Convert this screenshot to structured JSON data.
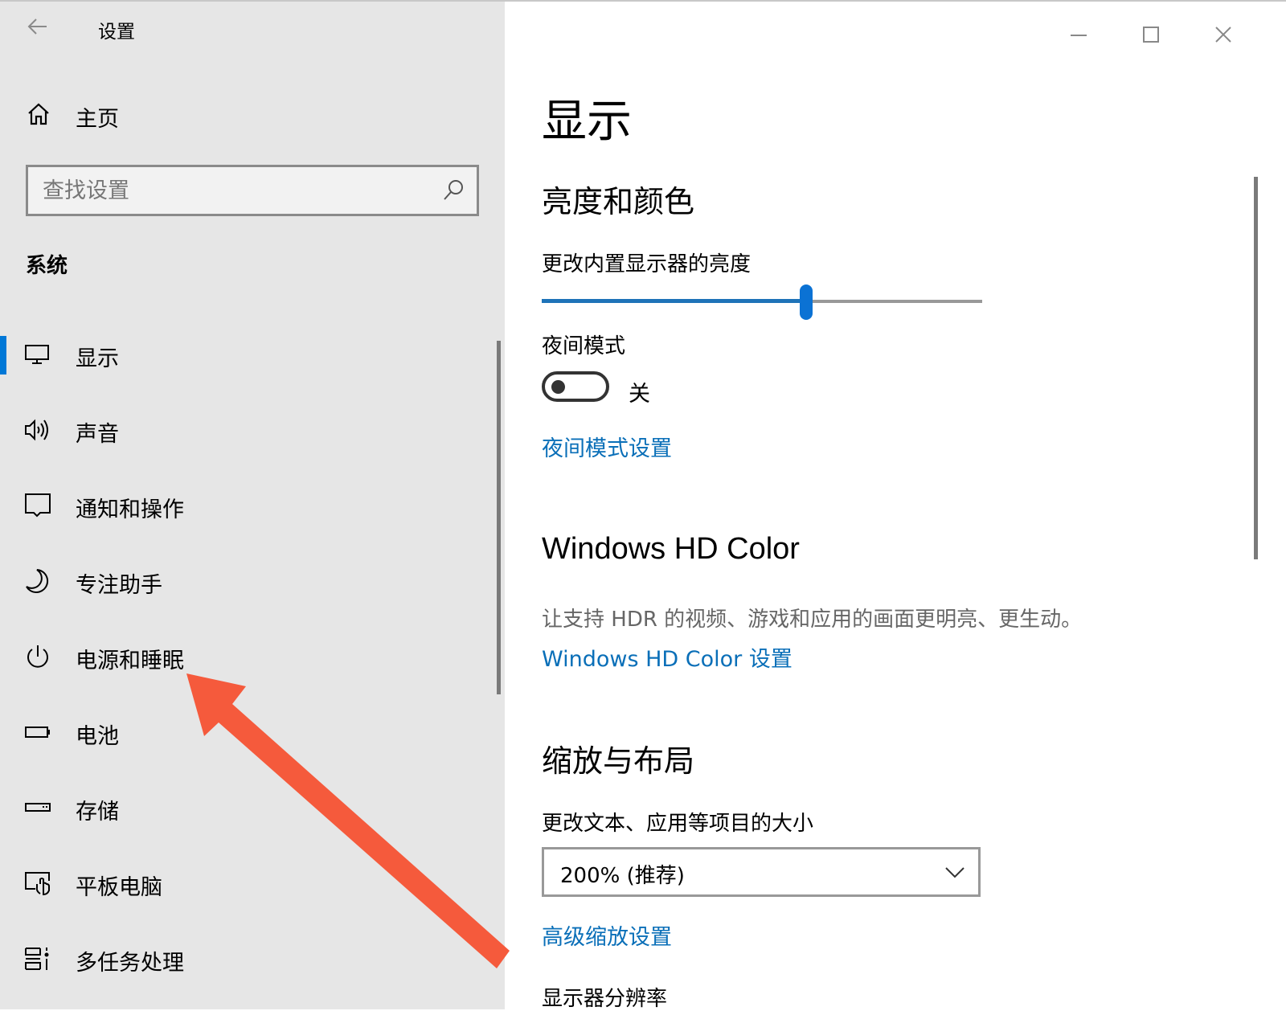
{
  "window": {
    "app_title": "设置",
    "controls": {
      "minimize": "minimize-icon",
      "maximize": "maximize-icon",
      "close": "close-icon"
    }
  },
  "sidebar": {
    "back_icon": "arrow-left-icon",
    "home": {
      "label": "主页",
      "icon": "home-icon"
    },
    "search": {
      "placeholder": "查找设置",
      "value": "",
      "icon": "search-icon"
    },
    "group_title": "系统",
    "items": [
      {
        "label": "显示",
        "icon": "monitor-icon",
        "selected": true
      },
      {
        "label": "声音",
        "icon": "speaker-icon",
        "selected": false
      },
      {
        "label": "通知和操作",
        "icon": "notification-icon",
        "selected": false
      },
      {
        "label": "专注助手",
        "icon": "moon-icon",
        "selected": false
      },
      {
        "label": "电源和睡眠",
        "icon": "power-icon",
        "selected": false
      },
      {
        "label": "电池",
        "icon": "battery-icon",
        "selected": false
      },
      {
        "label": "存储",
        "icon": "storage-icon",
        "selected": false
      },
      {
        "label": "平板电脑",
        "icon": "tablet-icon",
        "selected": false
      },
      {
        "label": "多任务处理",
        "icon": "multitask-icon",
        "selected": false
      }
    ],
    "accent_color": "#0078d7"
  },
  "main": {
    "page_title": "显示",
    "brightness_section": {
      "heading": "亮度和颜色",
      "slider_label": "更改内置显示器的亮度",
      "brightness_percent": 60,
      "night_light_label": "夜间模式",
      "night_light_state": "关",
      "night_light_on": false,
      "night_light_link": "夜间模式设置"
    },
    "hd_color_section": {
      "heading": "Windows HD Color",
      "description": "让支持 HDR 的视频、游戏和应用的画面更明亮、更生动。",
      "link": "Windows HD Color 设置"
    },
    "scale_section": {
      "heading": "缩放与布局",
      "scale_label": "更改文本、应用等项目的大小",
      "scale_value": "200% (推荐)",
      "advanced_link": "高级缩放设置",
      "resolution_label_partial": "显示器分辨率"
    },
    "link_color": "#0a6fb8"
  },
  "annotation": {
    "type": "arrow",
    "color": "#f55a3c",
    "points_to": "电源和睡眠"
  }
}
